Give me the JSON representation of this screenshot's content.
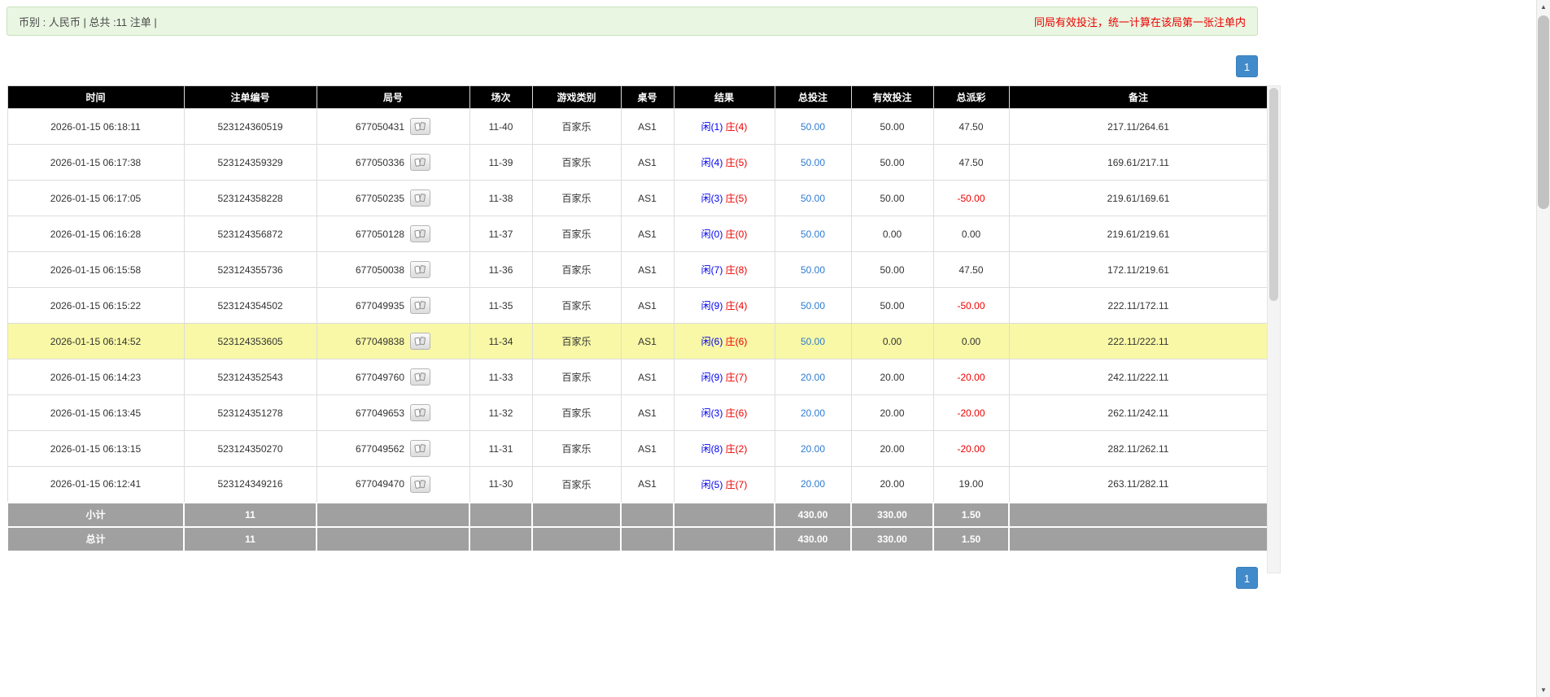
{
  "top_bar": {
    "summary": "币别 : 人民币 | 总共 :11 注单 |",
    "notice": "同局有效投注，统一计算在该局第一张注单内"
  },
  "pagination": {
    "top": "1",
    "bottom": "1"
  },
  "icons": {
    "view_cards": "playing-cards-icon",
    "up_glyph": "▲",
    "down_glyph": "▼"
  },
  "colors": {
    "header_bg": "#000000",
    "highlight_row": "#f8f8a6",
    "player_blue": "#0000ee",
    "banker_red": "#ee0000",
    "bet_link_blue": "#2e7bd0",
    "negative_red": "#ee0000",
    "footer_bg": "#a0a0a0",
    "alert_bg": "#e9f6e2",
    "notice_red": "#ee0000",
    "pagination_blue": "#428bca"
  },
  "table": {
    "headers": [
      "时间",
      "注单编号",
      "局号",
      "场次",
      "游戏类别",
      "桌号",
      "结果",
      "总投注",
      "有效投注",
      "总派彩",
      "备注"
    ],
    "rows": [
      {
        "time": "2026-01-15 06:18:11",
        "bet_id": "523124360519",
        "round_id": "677050431",
        "session": "11-40",
        "game_type": "百家乐",
        "table_no": "AS1",
        "player": "闲(1)",
        "banker": "庄(4)",
        "total_bet": "50.00",
        "valid_bet": "50.00",
        "payout": "47.50",
        "negative": false,
        "remark": "217.11/264.61",
        "highlight": false
      },
      {
        "time": "2026-01-15 06:17:38",
        "bet_id": "523124359329",
        "round_id": "677050336",
        "session": "11-39",
        "game_type": "百家乐",
        "table_no": "AS1",
        "player": "闲(4)",
        "banker": "庄(5)",
        "total_bet": "50.00",
        "valid_bet": "50.00",
        "payout": "47.50",
        "negative": false,
        "remark": "169.61/217.11",
        "highlight": false
      },
      {
        "time": "2026-01-15 06:17:05",
        "bet_id": "523124358228",
        "round_id": "677050235",
        "session": "11-38",
        "game_type": "百家乐",
        "table_no": "AS1",
        "player": "闲(3)",
        "banker": "庄(5)",
        "total_bet": "50.00",
        "valid_bet": "50.00",
        "payout": "-50.00",
        "negative": true,
        "remark": "219.61/169.61",
        "highlight": false
      },
      {
        "time": "2026-01-15 06:16:28",
        "bet_id": "523124356872",
        "round_id": "677050128",
        "session": "11-37",
        "game_type": "百家乐",
        "table_no": "AS1",
        "player": "闲(0)",
        "banker": "庄(0)",
        "total_bet": "50.00",
        "valid_bet": "0.00",
        "payout": "0.00",
        "negative": false,
        "remark": "219.61/219.61",
        "highlight": false
      },
      {
        "time": "2026-01-15 06:15:58",
        "bet_id": "523124355736",
        "round_id": "677050038",
        "session": "11-36",
        "game_type": "百家乐",
        "table_no": "AS1",
        "player": "闲(7)",
        "banker": "庄(8)",
        "total_bet": "50.00",
        "valid_bet": "50.00",
        "payout": "47.50",
        "negative": false,
        "remark": "172.11/219.61",
        "highlight": false
      },
      {
        "time": "2026-01-15 06:15:22",
        "bet_id": "523124354502",
        "round_id": "677049935",
        "session": "11-35",
        "game_type": "百家乐",
        "table_no": "AS1",
        "player": "闲(9)",
        "banker": "庄(4)",
        "total_bet": "50.00",
        "valid_bet": "50.00",
        "payout": "-50.00",
        "negative": true,
        "remark": "222.11/172.11",
        "highlight": false
      },
      {
        "time": "2026-01-15 06:14:52",
        "bet_id": "523124353605",
        "round_id": "677049838",
        "session": "11-34",
        "game_type": "百家乐",
        "table_no": "AS1",
        "player": "闲(6)",
        "banker": "庄(6)",
        "total_bet": "50.00",
        "valid_bet": "0.00",
        "payout": "0.00",
        "negative": false,
        "remark": "222.11/222.11",
        "highlight": true
      },
      {
        "time": "2026-01-15 06:14:23",
        "bet_id": "523124352543",
        "round_id": "677049760",
        "session": "11-33",
        "game_type": "百家乐",
        "table_no": "AS1",
        "player": "闲(9)",
        "banker": "庄(7)",
        "total_bet": "20.00",
        "valid_bet": "20.00",
        "payout": "-20.00",
        "negative": true,
        "remark": "242.11/222.11",
        "highlight": false
      },
      {
        "time": "2026-01-15 06:13:45",
        "bet_id": "523124351278",
        "round_id": "677049653",
        "session": "11-32",
        "game_type": "百家乐",
        "table_no": "AS1",
        "player": "闲(3)",
        "banker": "庄(6)",
        "total_bet": "20.00",
        "valid_bet": "20.00",
        "payout": "-20.00",
        "negative": true,
        "remark": "262.11/242.11",
        "highlight": false
      },
      {
        "time": "2026-01-15 06:13:15",
        "bet_id": "523124350270",
        "round_id": "677049562",
        "session": "11-31",
        "game_type": "百家乐",
        "table_no": "AS1",
        "player": "闲(8)",
        "banker": "庄(2)",
        "total_bet": "20.00",
        "valid_bet": "20.00",
        "payout": "-20.00",
        "negative": true,
        "remark": "282.11/262.11",
        "highlight": false
      },
      {
        "time": "2026-01-15 06:12:41",
        "bet_id": "523124349216",
        "round_id": "677049470",
        "session": "11-30",
        "game_type": "百家乐",
        "table_no": "AS1",
        "player": "闲(5)",
        "banker": "庄(7)",
        "total_bet": "20.00",
        "valid_bet": "20.00",
        "payout": "19.00",
        "negative": false,
        "remark": "263.11/282.11",
        "highlight": false
      }
    ],
    "subtotal": {
      "label": "小计",
      "count": "11",
      "total_bet": "430.00",
      "valid_bet": "330.00",
      "payout": "1.50"
    },
    "total": {
      "label": "总计",
      "count": "11",
      "total_bet": "430.00",
      "valid_bet": "330.00",
      "payout": "1.50"
    }
  }
}
